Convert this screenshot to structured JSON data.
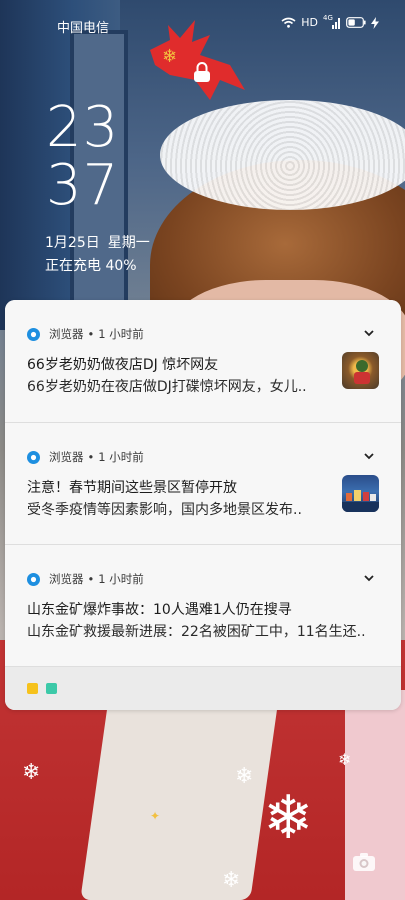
{
  "status_bar": {
    "carrier": "中国电信",
    "hd_label": "HD",
    "network_label": "4G"
  },
  "lockscreen": {
    "hour": "23",
    "minute": "37",
    "date": "1月25日",
    "weekday": "星期一",
    "charging_status": "正在充电 40%"
  },
  "notifications": [
    {
      "app": "浏览器",
      "separator": "•",
      "time": "1 小时前",
      "title": "66岁老奶奶做夜店DJ 惊坏网友",
      "body": "66岁老奶奶在夜店做DJ打碟惊坏网友，女儿..",
      "has_thumbnail": true
    },
    {
      "app": "浏览器",
      "separator": "•",
      "time": "1 小时前",
      "title": "注意！春节期间这些景区暂停开放",
      "body": "受冬季疫情等因素影响，国内多地景区发布..",
      "has_thumbnail": true
    },
    {
      "app": "浏览器",
      "separator": "•",
      "time": "1 小时前",
      "title": "山东金矿爆炸事故：10人遇难1人仍在搜寻",
      "body": "山东金矿救援最新进展：22名被困矿工中，11名生还..",
      "has_thumbnail": false
    }
  ],
  "colors": {
    "panel": "#f7f7f7",
    "accent_blue": "#1e8fe0",
    "footer_yellow": "#f6c21c",
    "footer_green": "#3cc9a8"
  },
  "icons": {
    "lock": "lock-icon",
    "wifi": "wifi-icon",
    "signal": "signal-icon",
    "battery": "battery-icon",
    "charging": "charging-bolt-icon",
    "camera": "camera-icon"
  }
}
